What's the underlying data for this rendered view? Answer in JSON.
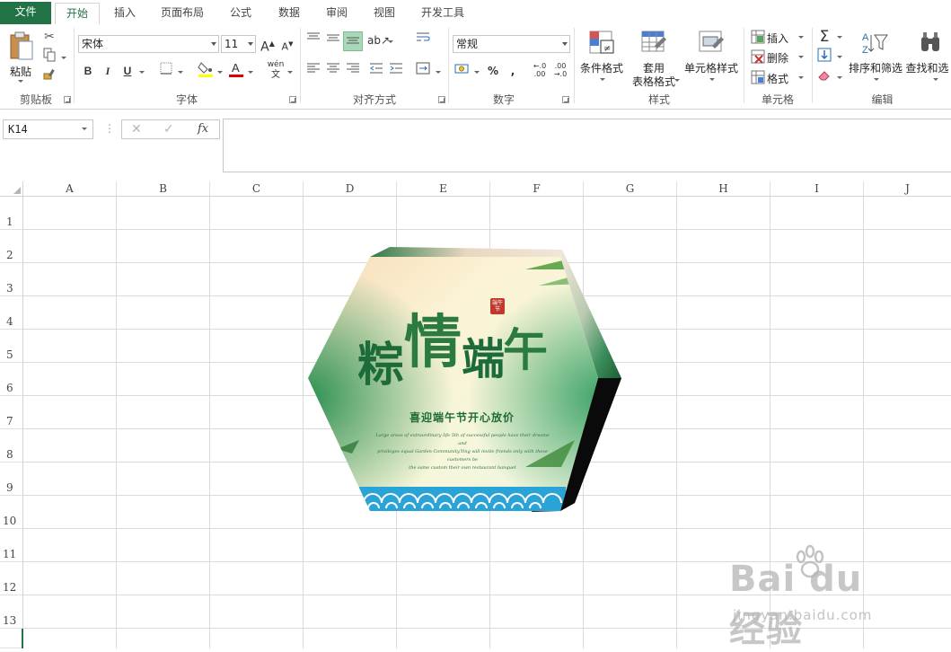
{
  "tabs": [
    "文件",
    "开始",
    "插入",
    "页面布局",
    "公式",
    "数据",
    "审阅",
    "视图",
    "开发工具"
  ],
  "active_tab": "开始",
  "ribbon": {
    "clipboard": {
      "paste_label": "粘贴",
      "group_label": "剪贴板"
    },
    "font": {
      "font_name": "宋体",
      "font_size": "11",
      "bold": "B",
      "italic": "I",
      "underline": "U",
      "grow": "A",
      "shrink": "A",
      "phonetic": "wén",
      "group_label": "字体"
    },
    "alignment": {
      "group_label": "对齐方式"
    },
    "number": {
      "format": "常规",
      "percent": "%",
      "comma": ",",
      "inc_decimal": "←.0 .00",
      "dec_decimal": ".00 →.0",
      "group_label": "数字"
    },
    "styles": {
      "conditional_format": "条件格式",
      "table_format_1": "套用",
      "table_format_2": "表格格式",
      "cell_styles": "单元格样式",
      "group_label": "样式"
    },
    "cells": {
      "insert": "插入",
      "delete": "删除",
      "format": "格式",
      "group_label": "单元格"
    },
    "editing": {
      "sort_filter": "排序和筛选",
      "find_select": "查找和选",
      "group_label": "编辑"
    }
  },
  "formula_bar": {
    "name_box": "K14",
    "cancel": "✕",
    "enter": "✓",
    "fx": "fx",
    "formula": ""
  },
  "columns": [
    "A",
    "B",
    "C",
    "D",
    "E",
    "F",
    "G",
    "H",
    "I",
    "J"
  ],
  "rows": [
    "1",
    "2",
    "3",
    "4",
    "5",
    "6",
    "7",
    "8",
    "9",
    "10",
    "11",
    "12",
    "13"
  ],
  "shape": {
    "title_chars": [
      "粽",
      "情",
      "端",
      "午"
    ],
    "subtitle": "喜迎端午节开心放价",
    "seal": "端午节",
    "small_lines": [
      "Large areas of extraordinary life 5th of successful people have their dreams and",
      "privileges equal Garden Community.Ying will invite friends only with these customers be",
      "the same custom their own restaurant banquet"
    ],
    "colors": {
      "green": "#3a9a5a",
      "dark_green": "#1e6b3a",
      "cream": "#fbf6d6",
      "wave_blue": "#2aa3d6",
      "side_dark": "#111111"
    }
  },
  "watermark": {
    "brand": "Bai du 经验",
    "sub": "jingyan.baidu.com"
  }
}
